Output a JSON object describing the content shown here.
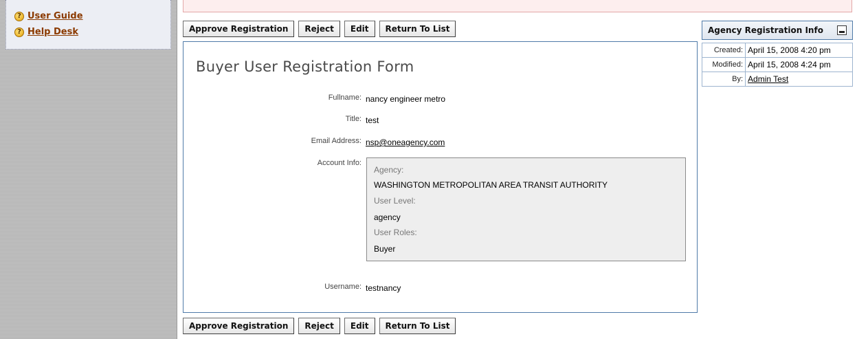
{
  "sidebar": {
    "help_links": [
      {
        "label": "User Guide",
        "icon": "help-icon"
      },
      {
        "label": "Help Desk",
        "icon": "help-icon"
      }
    ]
  },
  "actions": {
    "approve_label": "Approve Registration",
    "reject_label": "Reject",
    "edit_label": "Edit",
    "return_label": "Return To List"
  },
  "form": {
    "title": "Buyer User Registration Form",
    "fullname_label": "Fullname:",
    "fullname": "nancy engineer metro",
    "title_label": "Title:",
    "title_value": "test",
    "email_label": "Email Address:",
    "email": "nsp@oneagency.com",
    "account_label": "Account Info:",
    "account": {
      "agency_label": "Agency:",
      "agency": "WASHINGTON METROPOLITAN AREA TRANSIT AUTHORITY",
      "level_label": "User Level:",
      "level": "agency",
      "roles_label": "User Roles:",
      "roles": "Buyer"
    },
    "username_label": "Username:",
    "username": "testnancy"
  },
  "info": {
    "header": "Agency Registration Info",
    "created_label": "Created:",
    "created": "April 15, 2008 4:20 pm",
    "modified_label": "Modified:",
    "modified": "April 15, 2008 4:24 pm",
    "by_label": "By:",
    "by": "Admin Test"
  },
  "colors": {
    "panel_border": "#4f7aa8",
    "help_link": "#8b3a00",
    "alert_background": "#fdeeee"
  }
}
